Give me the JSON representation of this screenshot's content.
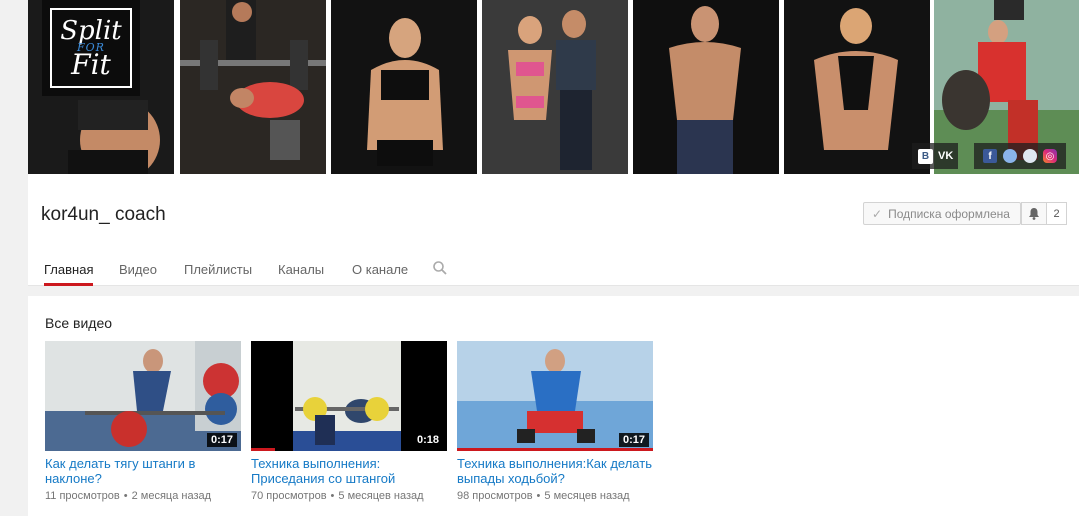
{
  "banner": {
    "logo": {
      "line1": "Split",
      "line2": "FOR",
      "line3": "Fit"
    },
    "social": {
      "vk_label": "VK",
      "icons": [
        "facebook-icon",
        "globe-icon",
        "globe-icon",
        "instagram-icon"
      ]
    }
  },
  "channel": {
    "name": "kor4un_ coach",
    "subscribe_label": "Подписка оформлена",
    "subscriber_count": "2"
  },
  "tabs": [
    {
      "label": "Главная",
      "active": true
    },
    {
      "label": "Видео",
      "active": false
    },
    {
      "label": "Плейлисты",
      "active": false
    },
    {
      "label": "Каналы",
      "active": false
    },
    {
      "label": "О канале",
      "active": false
    }
  ],
  "section": {
    "title": "Все видео",
    "videos": [
      {
        "title": "Как делать тягу штанги в наклоне?",
        "duration": "0:17",
        "views": "11 просмотров",
        "age": "2 месяца назад",
        "watched_fraction": 0
      },
      {
        "title": "Техника выполнения: Приседания со штангой",
        "duration": "0:18",
        "views": "70 просмотров",
        "age": "5 месяцев назад",
        "watched_fraction": 0.12
      },
      {
        "title": "Техника выполнения:Как делать выпады ходьбой?",
        "duration": "0:17",
        "views": "98 просмотров",
        "age": "5 месяцев назад",
        "watched_fraction": 1
      }
    ]
  },
  "colors": {
    "accent": "#cc181e",
    "link": "#167ac6"
  }
}
